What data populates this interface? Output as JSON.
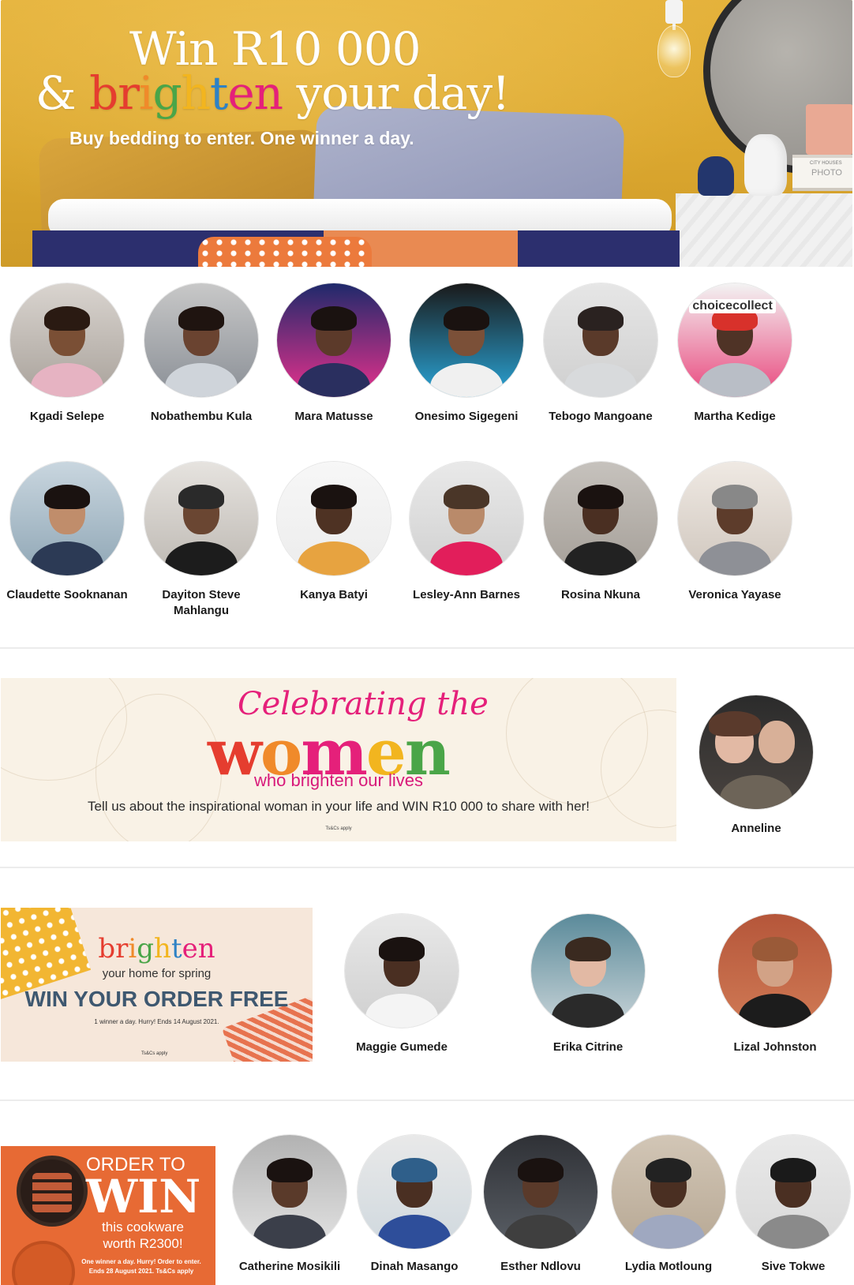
{
  "hero": {
    "title_line1": "Win R10 000",
    "title_amp": "& ",
    "title_brighten": [
      "b",
      "r",
      "i",
      "g",
      "h",
      "t",
      "e",
      "n"
    ],
    "title_rest": " your day!",
    "subtitle": "Buy bedding to enter. One winner a day.",
    "book_label_1": "CITY HOUSES",
    "book_label_2": "PHOTO",
    "colors": {
      "wall": "#e0ad35",
      "brighten_letters": [
        "#e53d2f",
        "#e53d2f",
        "#f08a2a",
        "#4aa548",
        "#f2b51f",
        "#2e82c5",
        "#e5207a",
        "#e5207a"
      ]
    }
  },
  "winners_row1": [
    {
      "name": "Kgadi Selepe",
      "icon": "winner-photo"
    },
    {
      "name": "Nobathembu Kula",
      "icon": "winner-photo"
    },
    {
      "name": "Mara Matusse",
      "icon": "winner-photo"
    },
    {
      "name": "Onesimo Sigegeni",
      "icon": "winner-photo"
    },
    {
      "name": "Tebogo Mangoane",
      "icon": "winner-photo"
    },
    {
      "name": "Martha Kedige",
      "icon": "winner-photo",
      "sign": "choicecollect"
    }
  ],
  "winners_row2": [
    {
      "name": "Claudette Sooknanan"
    },
    {
      "name": "Dayiton Steve Mahlangu"
    },
    {
      "name": "Kanya Batyi"
    },
    {
      "name": "Lesley-Ann Barnes"
    },
    {
      "name": "Rosina Nkuna"
    },
    {
      "name": "Veronica Yayase"
    }
  ],
  "women_banner": {
    "script": "Celebrating the",
    "word_letters": [
      "w",
      "o",
      "m",
      "e",
      "n"
    ],
    "word_colors": [
      "#e53d2f",
      "#f08a2a",
      "#e5207a",
      "#f2b51f",
      "#4aa548"
    ],
    "sub": "who brighten our lives",
    "cta": "Tell us about the inspirational woman in your life and WIN R10 000 to share with her!",
    "tc": "Ts&Cs apply"
  },
  "women_winner": {
    "name": "Anneline"
  },
  "spring_banner": {
    "brighten_letters": [
      "b",
      "r",
      "i",
      "g",
      "h",
      "t",
      "e",
      "n"
    ],
    "brighten_colors": [
      "#e53d2f",
      "#e53d2f",
      "#f08a2a",
      "#4aa548",
      "#f2b51f",
      "#2e82c5",
      "#e5207a",
      "#e5207a"
    ],
    "sub": "your home for spring",
    "headline": "WIN YOUR ORDER FREE",
    "small": "1 winner a day. Hurry! Ends 14 August 2021.",
    "tc": "Ts&Cs apply"
  },
  "spring_winners": [
    {
      "name": "Maggie Gumede"
    },
    {
      "name": "Erika Citrine"
    },
    {
      "name": "Lizal Johnston"
    }
  ],
  "cook_banner": {
    "order": "ORDER TO",
    "win": "WIN",
    "this": "this cookware",
    "worth": "worth R2300!",
    "small1": "One winner a day. Hurry! Order to enter.",
    "small2": "Ends 28 August 2021. Ts&Cs apply"
  },
  "cook_winners": [
    {
      "name": "Catherine Mosikili"
    },
    {
      "name": "Dinah Masango"
    },
    {
      "name": "Esther Ndlovu"
    },
    {
      "name": "Lydia Motloung"
    },
    {
      "name": "Sive Tokwe"
    }
  ]
}
